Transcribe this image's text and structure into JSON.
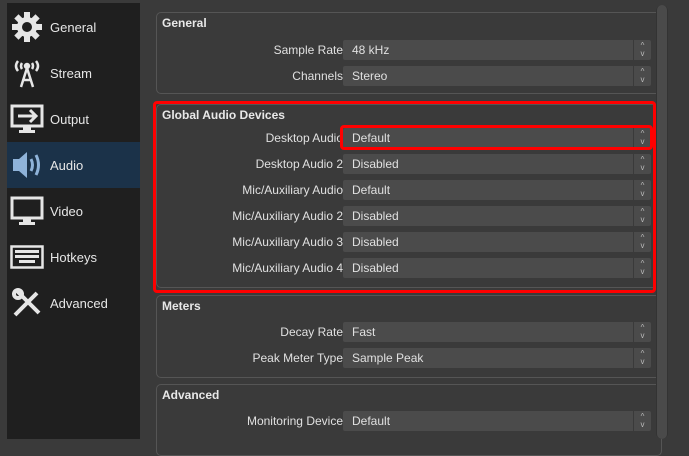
{
  "sidebar": {
    "items": [
      {
        "label": "General",
        "icon": "gear-icon"
      },
      {
        "label": "Stream",
        "icon": "antenna-icon"
      },
      {
        "label": "Output",
        "icon": "output-monitor-icon"
      },
      {
        "label": "Audio",
        "icon": "speaker-icon",
        "selected": true
      },
      {
        "label": "Video",
        "icon": "monitor-icon"
      },
      {
        "label": "Hotkeys",
        "icon": "keyboard-icon"
      },
      {
        "label": "Advanced",
        "icon": "tools-icon"
      }
    ]
  },
  "general": {
    "title": "General",
    "rows": [
      {
        "label": "Sample Rate",
        "value": "48 kHz"
      },
      {
        "label": "Channels",
        "value": "Stereo"
      }
    ]
  },
  "devices": {
    "title": "Global Audio Devices",
    "rows": [
      {
        "label": "Desktop Audio",
        "value": "Default"
      },
      {
        "label": "Desktop Audio 2",
        "value": "Disabled"
      },
      {
        "label": "Mic/Auxiliary Audio",
        "value": "Default"
      },
      {
        "label": "Mic/Auxiliary Audio 2",
        "value": "Disabled"
      },
      {
        "label": "Mic/Auxiliary Audio 3",
        "value": "Disabled"
      },
      {
        "label": "Mic/Auxiliary Audio 4",
        "value": "Disabled"
      }
    ]
  },
  "meters": {
    "title": "Meters",
    "rows": [
      {
        "label": "Decay Rate",
        "value": "Fast"
      },
      {
        "label": "Peak Meter Type",
        "value": "Sample Peak"
      }
    ]
  },
  "advanced": {
    "title": "Advanced",
    "rows": [
      {
        "label": "Monitoring Device",
        "value": "Default"
      }
    ]
  },
  "colors": {
    "highlight": "#ff0000",
    "selected": "#1b3249"
  }
}
